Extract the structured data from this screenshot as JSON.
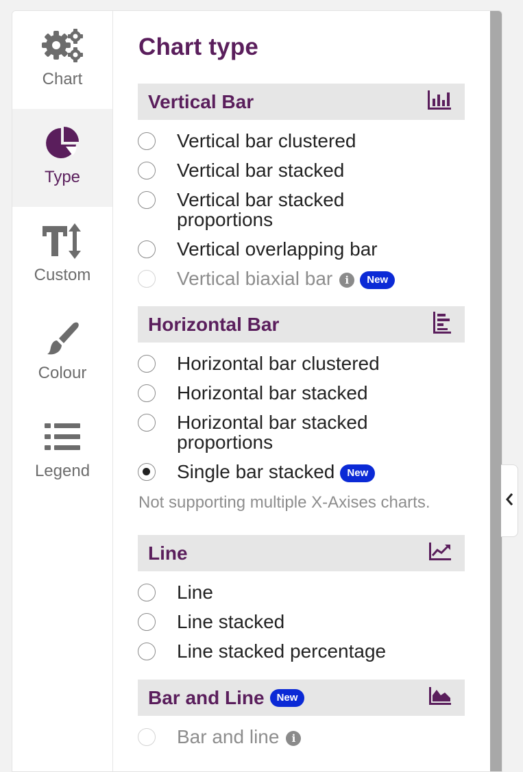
{
  "sidebar": {
    "items": [
      {
        "label": "Chart",
        "icon": "gears-icon"
      },
      {
        "label": "Type",
        "icon": "pie-chart-icon"
      },
      {
        "label": "Custom",
        "icon": "text-size-icon"
      },
      {
        "label": "Colour",
        "icon": "brush-icon"
      },
      {
        "label": "Legend",
        "icon": "list-icon"
      }
    ],
    "active": "Type"
  },
  "main": {
    "title": "Chart type",
    "new_badge": "New",
    "sections": [
      {
        "title": "Vertical Bar",
        "icon": "vertical-bar-chart-icon",
        "options": [
          {
            "label": "Vertical bar clustered",
            "selected": false,
            "disabled": false
          },
          {
            "label": "Vertical bar stacked",
            "selected": false,
            "disabled": false
          },
          {
            "label": "Vertical bar stacked proportions",
            "selected": false,
            "disabled": false
          },
          {
            "label": "Vertical overlapping bar",
            "selected": false,
            "disabled": false
          },
          {
            "label": "Vertical biaxial bar",
            "selected": false,
            "disabled": true,
            "info": true,
            "badge": "New"
          }
        ]
      },
      {
        "title": "Horizontal Bar",
        "icon": "horizontal-bar-chart-icon",
        "options": [
          {
            "label": "Horizontal bar clustered",
            "selected": false,
            "disabled": false
          },
          {
            "label": "Horizontal bar stacked",
            "selected": false,
            "disabled": false
          },
          {
            "label": "Horizontal bar stacked proportions",
            "selected": false,
            "disabled": false
          },
          {
            "label": "Single bar stacked",
            "selected": true,
            "disabled": false,
            "badge": "New"
          }
        ],
        "note": "Not supporting multiple X-Axises charts."
      },
      {
        "title": "Line",
        "icon": "line-chart-icon",
        "options": [
          {
            "label": "Line",
            "selected": false,
            "disabled": false
          },
          {
            "label": "Line stacked",
            "selected": false,
            "disabled": false
          },
          {
            "label": "Line stacked percentage",
            "selected": false,
            "disabled": false
          }
        ]
      },
      {
        "title": "Bar and Line",
        "badge": "New",
        "icon": "area-chart-icon",
        "options": [
          {
            "label": "Bar and line",
            "selected": false,
            "disabled": true,
            "info": true
          }
        ]
      }
    ]
  },
  "colors": {
    "brand_purple": "#5a1e5c",
    "badge_blue": "#0b2ad6",
    "section_bg": "#e6e6e6"
  }
}
